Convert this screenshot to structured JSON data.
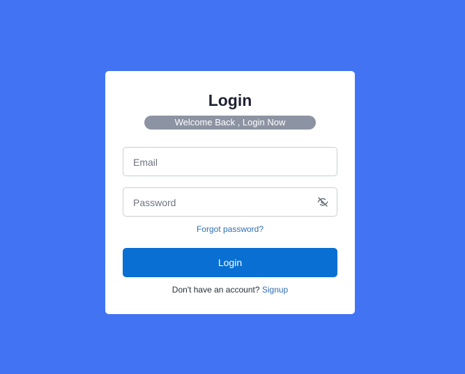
{
  "page": {
    "background_color": "#4173f3"
  },
  "login_card": {
    "title": "Login",
    "subtitle": "Welcome Back , Login Now",
    "email": {
      "placeholder": "Email",
      "value": ""
    },
    "password": {
      "placeholder": "Password",
      "value": "",
      "toggle_icon": "eye-off-icon"
    },
    "forgot_password_label": "Forgot password?",
    "login_button_label": "Login",
    "signup_prompt": "Don't have an account?",
    "signup_link_label": "Signup"
  },
  "colors": {
    "primary_button": "#0a6fd2",
    "link": "#2f6fb4",
    "subtitle_badge": "#8c93a2"
  }
}
